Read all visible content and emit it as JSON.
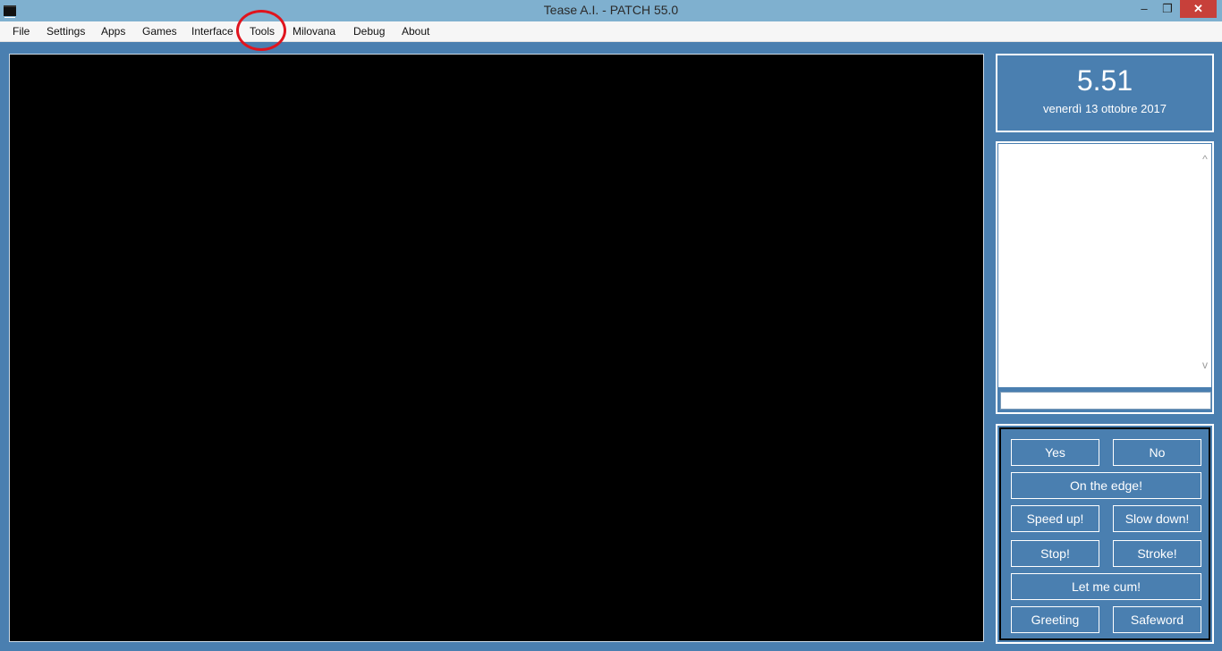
{
  "window": {
    "title": "Tease A.I. - PATCH 55.0",
    "controls": {
      "minimize": "‒",
      "maximize": "❐",
      "close": "✕"
    }
  },
  "menu": {
    "items": [
      "File",
      "Settings",
      "Apps",
      "Games",
      "Interface",
      "Tools",
      "Milovana",
      "Debug",
      "About"
    ],
    "highlighted": "Tools"
  },
  "clock": {
    "time": "5.51",
    "date": "venerdì 13 ottobre 2017"
  },
  "chat": {
    "scroll_up": "^",
    "scroll_down": "v",
    "input_value": ""
  },
  "buttons": {
    "yes": "Yes",
    "no": "No",
    "edge": "On the edge!",
    "speed_up": "Speed up!",
    "slow_down": "Slow down!",
    "stop": "Stop!",
    "stroke": "Stroke!",
    "let_me_cum": "Let me cum!",
    "greeting": "Greeting",
    "safeword": "Safeword"
  },
  "colors": {
    "background": "#4a7fb0",
    "titlebar": "#7fb0cf",
    "highlight_circle": "#e0141e",
    "close_button": "#c7403a"
  }
}
